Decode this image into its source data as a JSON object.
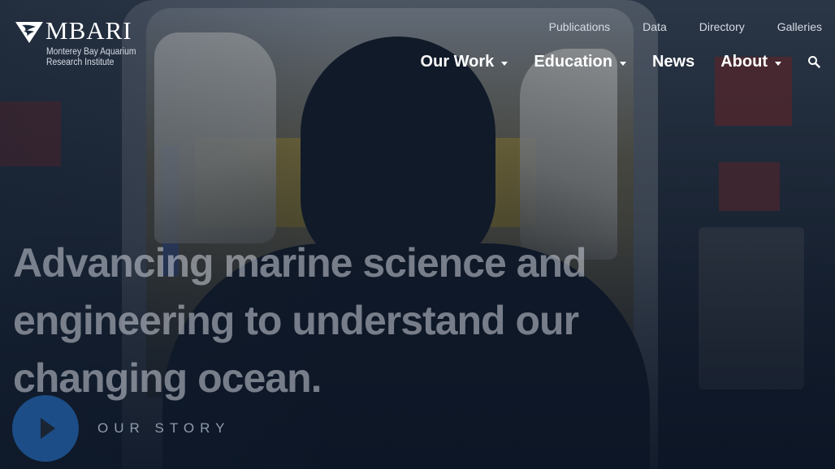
{
  "logo": {
    "name": "MBARI",
    "subtitle_line1": "Monterey Bay Aquarium",
    "subtitle_line2": "Research Institute"
  },
  "utility_nav": [
    "Publications",
    "Data",
    "Directory",
    "Galleries"
  ],
  "main_nav": [
    {
      "label": "Our Work",
      "dropdown": true
    },
    {
      "label": "Education",
      "dropdown": true
    },
    {
      "label": "News",
      "dropdown": false
    },
    {
      "label": "About",
      "dropdown": true
    }
  ],
  "search_icon": "search-icon",
  "hero": {
    "headline_line1": "Advancing marine science and",
    "headline_line2": "engineering to understand our",
    "headline_line3": "changing ocean.",
    "cta_label": "OUR STORY"
  },
  "colors": {
    "play_button": "#1c4d86",
    "headline": "rgba(205,210,218,0.55)"
  }
}
